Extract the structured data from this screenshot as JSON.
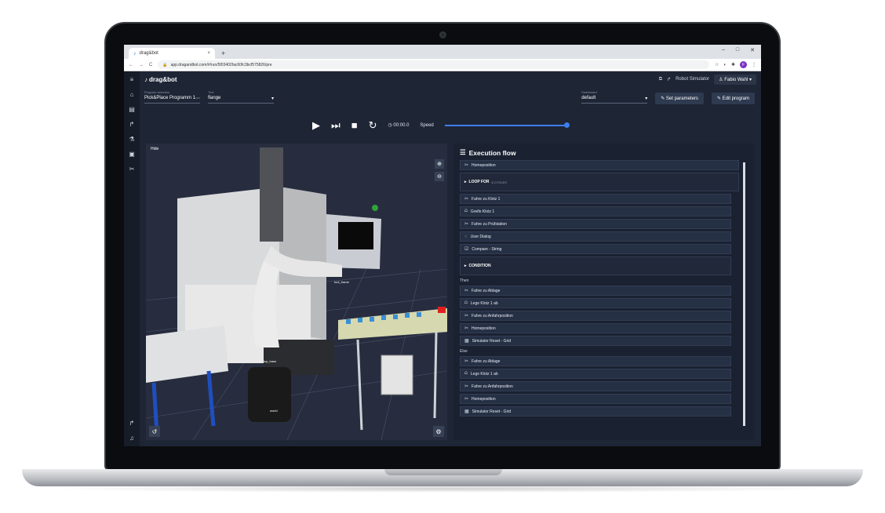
{
  "browser": {
    "tab_title": "drag&bot",
    "url": "app.dragandbot.com/#/run/5f03402fac60fc3bcf575826/pre",
    "avatar_letter": "F"
  },
  "app": {
    "logo": "drag&bot",
    "robot_simulator_label": "Robot Simulator",
    "user_label": "Fabio Wahl"
  },
  "program": {
    "program_label": "Program selection",
    "program_value": "Pick&Place Programm 1",
    "tool_label": "Tool",
    "tool_value": "flange",
    "dashboard_label": "Dashboard",
    "dashboard_value": "default",
    "set_parameters": "Set parameters",
    "edit_program": "Edit program"
  },
  "controls": {
    "time": "00:00.0",
    "speed_label": "Speed",
    "speed_level": 1.0
  },
  "viewer": {
    "hide_label": "Hide",
    "labels": [
      "tool_frame",
      "tcp_base",
      "world"
    ]
  },
  "flow": {
    "title": "Execution flow",
    "top": [
      {
        "icon": "✂",
        "label": "Homeposition"
      }
    ],
    "loop": {
      "label": "LOOP FOR",
      "count": "6 CYCLES"
    },
    "loop_items": [
      {
        "icon": "✂",
        "label": "Fahre zu Klotz 1"
      },
      {
        "icon": "⩍",
        "label": "Greife Klotz 1"
      },
      {
        "icon": "✂",
        "label": "Fahre zu Prüfstation"
      },
      {
        "icon": "◌",
        "label": "User Dialog"
      },
      {
        "icon": "☑",
        "label": "Compare - String"
      }
    ],
    "condition_label": "CONDITION",
    "then_label": "Then",
    "then_items": [
      {
        "icon": "✂",
        "label": "Fahre zu Ablage"
      },
      {
        "icon": "⩍",
        "label": "Lege Klotz 1 ab"
      },
      {
        "icon": "✂",
        "label": "Fahre zu Anfahrposition"
      },
      {
        "icon": "✂",
        "label": "Homeposition"
      },
      {
        "icon": "▦",
        "label": "Simulator Reset - Grid"
      }
    ],
    "else_label": "Else",
    "else_items": [
      {
        "icon": "✂",
        "label": "Fahre zu Ablage"
      },
      {
        "icon": "⩍",
        "label": "Lege Klotz 1 ab"
      },
      {
        "icon": "✂",
        "label": "Fahre zu Anfahrposition"
      },
      {
        "icon": "✂",
        "label": "Homeposition"
      },
      {
        "icon": "▦",
        "label": "Simulator Reset - Grid"
      }
    ]
  },
  "colors": {
    "accent": "#3d7ef0",
    "app_bg": "#1e2535",
    "panel_bg": "#1a2131"
  }
}
